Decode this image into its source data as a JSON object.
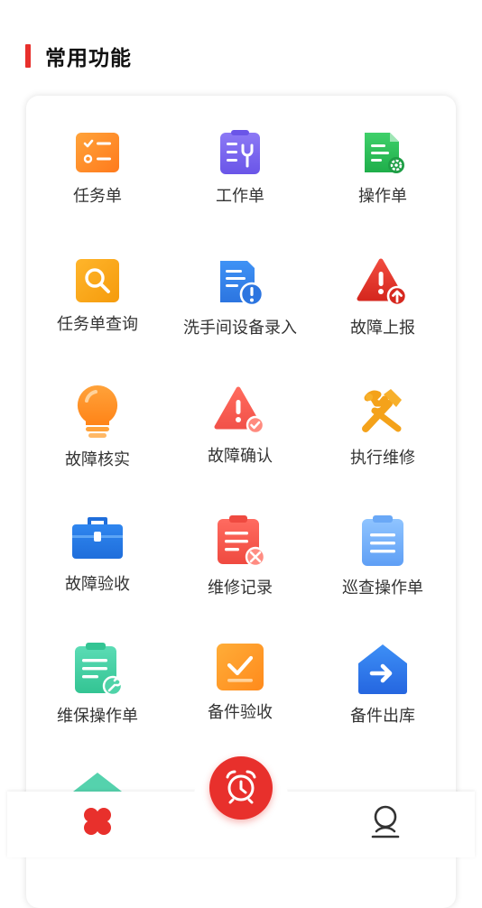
{
  "section": {
    "title": "常用功能"
  },
  "items": [
    {
      "label": "任务单",
      "icon": "task-list-icon"
    },
    {
      "label": "工作单",
      "icon": "work-order-icon"
    },
    {
      "label": "操作单",
      "icon": "operation-order-icon"
    },
    {
      "label": "任务单查询",
      "icon": "search-icon"
    },
    {
      "label": "洗手间设备录入",
      "icon": "document-alert-icon"
    },
    {
      "label": "故障上报",
      "icon": "warning-upload-icon"
    },
    {
      "label": "故障核实",
      "icon": "lightbulb-icon"
    },
    {
      "label": "故障确认",
      "icon": "warning-check-icon"
    },
    {
      "label": "执行维修",
      "icon": "tools-icon"
    },
    {
      "label": "故障验收",
      "icon": "toolbox-icon"
    },
    {
      "label": "维修记录",
      "icon": "clipboard-repair-icon"
    },
    {
      "label": "巡查操作单",
      "icon": "clipboard-icon"
    },
    {
      "label": "维保操作单",
      "icon": "clipboard-wrench-icon"
    },
    {
      "label": "备件验收",
      "icon": "checkbox-icon"
    },
    {
      "label": "备件出库",
      "icon": "house-arrow-icon"
    }
  ],
  "colors": {
    "accent": "#e8302c"
  },
  "bottom_nav": {
    "home_icon": "clover-icon",
    "center_icon": "alarm-clock-icon",
    "profile_icon": "user-icon"
  }
}
